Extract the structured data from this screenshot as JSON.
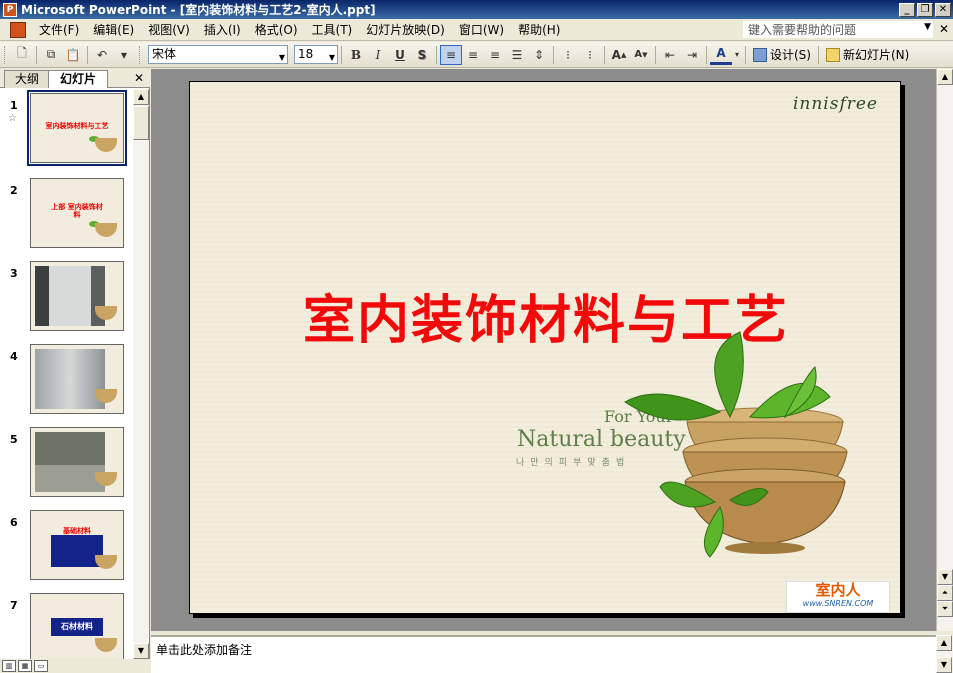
{
  "window": {
    "title": "Microsoft PowerPoint - [室内装饰材料与工艺2-室内人.ppt]",
    "minimize": "_",
    "restore": "❐",
    "close": "✕"
  },
  "menubar": {
    "items": [
      "文件(F)",
      "编辑(E)",
      "视图(V)",
      "插入(I)",
      "格式(O)",
      "工具(T)",
      "幻灯片放映(D)",
      "窗口(W)",
      "帮助(H)"
    ],
    "help_placeholder": "键入需要帮助的问题",
    "close_doc": "✕"
  },
  "toolbar": {
    "font_name": "宋体",
    "font_size": "18",
    "bold": "B",
    "italic": "I",
    "underline": "U",
    "shadow": "S",
    "design_label": "设计(S)",
    "new_slide_label": "新幻灯片(N)"
  },
  "left_pane": {
    "tab_outline": "大纲",
    "tab_slides": "幻灯片",
    "close": "✕",
    "thumbnails": [
      {
        "num": "1",
        "title": "室内装饰材料与工艺",
        "selected": true
      },
      {
        "num": "2",
        "title": "上部 室内装饰材料"
      },
      {
        "num": "3",
        "title": ""
      },
      {
        "num": "4",
        "title": ""
      },
      {
        "num": "5",
        "title": ""
      },
      {
        "num": "6",
        "title": "基础材料"
      },
      {
        "num": "7",
        "title": "石材材料"
      }
    ]
  },
  "slide": {
    "brand": "innisfree",
    "title": "室内装饰材料与工艺",
    "tagline_1": "For Your",
    "tagline_2": "Natural beauty",
    "tagline_korean": "나만의피부맞춤법",
    "watermark_main": "室内人",
    "watermark_sub": "www.SNREN.COM"
  },
  "notes": {
    "placeholder": "单击此处添加备注"
  },
  "colors": {
    "title_red": "#F20A0A",
    "slide_bg": "#F2EDDC",
    "titlebar_blue": "#0A246A",
    "tagline_green": "#5F7D48"
  }
}
